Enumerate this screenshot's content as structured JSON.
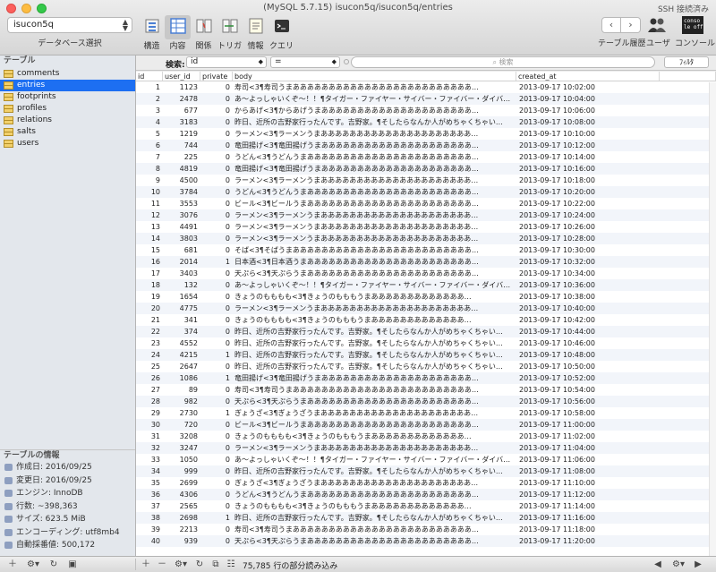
{
  "window": {
    "title": "(MySQL 5.7.15) isucon5q/isucon5q/entries",
    "ssh_status": "SSH 接続済み"
  },
  "toolbar": {
    "database_select": {
      "value": "isucon5q",
      "caption": "データベース選択"
    },
    "buttons": [
      {
        "label": "構造",
        "icon": "structure-icon"
      },
      {
        "label": "内容",
        "icon": "content-icon",
        "active": true
      },
      {
        "label": "関係",
        "icon": "relations-icon"
      },
      {
        "label": "トリガ",
        "icon": "triggers-icon"
      },
      {
        "label": "情報",
        "icon": "info-icon"
      },
      {
        "label": "クエリ",
        "icon": "query-icon"
      }
    ],
    "history_label": "テーブル履歴",
    "users_label": "ユーザ",
    "console_label": "コンソール",
    "console_badge": "conso\nle off"
  },
  "sidebar": {
    "header": "テーブル",
    "tables": [
      "comments",
      "entries",
      "footprints",
      "profiles",
      "relations",
      "salts",
      "users"
    ],
    "selected": "entries",
    "info_header": "テーブルの情報",
    "info": [
      "作成日: 2016/09/25",
      "変更日: 2016/09/25",
      "エンジン: InnoDB",
      "行数: ~398,363",
      "サイズ: 623.5 MiB",
      "エンコーディング: utf8mb4",
      "自動採番値: 500,172"
    ]
  },
  "filter": {
    "label": "検索:",
    "field": "id",
    "operator": "=",
    "search_placeholder": "検索",
    "button": "ﾌｨﾙﾀ"
  },
  "table": {
    "columns": [
      "id",
      "user_id",
      "private",
      "body",
      "created_at"
    ],
    "rows": [
      [
        "1",
        "1123",
        "0",
        "寿司<3¶寿司うまあああああああああああああああああああああああああ…",
        "2013-09-17 10:02:00"
      ],
      [
        "2",
        "2478",
        "0",
        "あ～よっしゃいくぞ～！！¶タイガー・ファイヤー・サイバー・ファイバー・ダイバ…",
        "2013-09-17 10:04:00"
      ],
      [
        "3",
        "677",
        "0",
        "からあげ<3¶からあげうまあああああああああああああああああああああ…",
        "2013-09-17 10:06:00"
      ],
      [
        "4",
        "3183",
        "0",
        "昨日、近所の吉野家行ったんです。吉野家。¶そしたらなんか人がめちゃくちゃい…",
        "2013-09-17 10:08:00"
      ],
      [
        "5",
        "1219",
        "0",
        "ラーメン<3¶ラーメンうまあああああああああああああああああああああ…",
        "2013-09-17 10:10:00"
      ],
      [
        "6",
        "744",
        "0",
        "竜田揚げ<3¶竜田揚げうまあああああああああああああああああああああ…",
        "2013-09-17 10:12:00"
      ],
      [
        "7",
        "225",
        "0",
        "うどん<3¶うどんうまあああああああああああああああああああああああ…",
        "2013-09-17 10:14:00"
      ],
      [
        "8",
        "4819",
        "0",
        "竜田揚げ<3¶竜田揚げうまあああああああああああああああああああああ…",
        "2013-09-17 10:16:00"
      ],
      [
        "9",
        "4500",
        "0",
        "ラーメン<3¶ラーメンうまあああああああああああああああああああああ…",
        "2013-09-17 10:18:00"
      ],
      [
        "10",
        "3784",
        "0",
        "うどん<3¶うどんうまあああああああああああああああああああああああ…",
        "2013-09-17 10:20:00"
      ],
      [
        "11",
        "3553",
        "0",
        "ビール<3¶ビールうまあああああああああああああああああああああああ…",
        "2013-09-17 10:22:00"
      ],
      [
        "12",
        "3076",
        "0",
        "ラーメン<3¶ラーメンうまあああああああああああああああああああああ…",
        "2013-09-17 10:24:00"
      ],
      [
        "13",
        "4491",
        "0",
        "ラーメン<3¶ラーメンうまあああああああああああああああああああああ…",
        "2013-09-17 10:26:00"
      ],
      [
        "14",
        "3803",
        "0",
        "ラーメン<3¶ラーメンうまあああああああああああああああああああああ…",
        "2013-09-17 10:28:00"
      ],
      [
        "15",
        "681",
        "0",
        "そば<3¶そばうまあああああああああああああああああああああああああ…",
        "2013-09-17 10:30:00"
      ],
      [
        "16",
        "2014",
        "1",
        "日本酒<3¶日本酒うまあああああああああああああああああああああああ…",
        "2013-09-17 10:32:00"
      ],
      [
        "17",
        "3403",
        "0",
        "天ぷら<3¶天ぷらうまあああああああああああああああああああああああ…",
        "2013-09-17 10:34:00"
      ],
      [
        "18",
        "132",
        "0",
        "あ～よっしゃいくぞ～！！¶タイガー・ファイヤー・サイバー・ファイバー・ダイバ…",
        "2013-09-17 10:36:00"
      ],
      [
        "19",
        "1654",
        "0",
        "きょうのもももも<3¶きょうのもももうまあああああああああああああ…",
        "2013-09-17 10:38:00"
      ],
      [
        "20",
        "4775",
        "0",
        "ラーメン<3¶ラーメンうまあああああああああああああああああああああ…",
        "2013-09-17 10:40:00"
      ],
      [
        "21",
        "341",
        "0",
        "きょうのもももも<3¶きょうのもももうまあああああああああああああ…",
        "2013-09-17 10:42:00"
      ],
      [
        "22",
        "374",
        "0",
        "昨日、近所の吉野家行ったんです。吉野家。¶そしたらなんか人がめちゃくちゃい…",
        "2013-09-17 10:44:00"
      ],
      [
        "23",
        "4552",
        "0",
        "昨日、近所の吉野家行ったんです。吉野家。¶そしたらなんか人がめちゃくちゃい…",
        "2013-09-17 10:46:00"
      ],
      [
        "24",
        "4215",
        "1",
        "昨日、近所の吉野家行ったんです。吉野家。¶そしたらなんか人がめちゃくちゃい…",
        "2013-09-17 10:48:00"
      ],
      [
        "25",
        "2647",
        "0",
        "昨日、近所の吉野家行ったんです。吉野家。¶そしたらなんか人がめちゃくちゃい…",
        "2013-09-17 10:50:00"
      ],
      [
        "26",
        "1086",
        "1",
        "竜田揚げ<3¶竜田揚げうまあああああああああああああああああああああ…",
        "2013-09-17 10:52:00"
      ],
      [
        "27",
        "89",
        "0",
        "寿司<3¶寿司うまあああああああああああああああああああああああああ…",
        "2013-09-17 10:54:00"
      ],
      [
        "28",
        "982",
        "0",
        "天ぷら<3¶天ぷらうまあああああああああああああああああああああああ…",
        "2013-09-17 10:56:00"
      ],
      [
        "29",
        "2730",
        "1",
        "ぎょうざ<3¶ぎょうざうまあああああああああああああああああああああ…",
        "2013-09-17 10:58:00"
      ],
      [
        "30",
        "720",
        "0",
        "ビール<3¶ビールうまあああああああああああああああああああああああ…",
        "2013-09-17 11:00:00"
      ],
      [
        "31",
        "3208",
        "0",
        "きょうのもももも<3¶きょうのもももうまあああああああああああああ…",
        "2013-09-17 11:02:00"
      ],
      [
        "32",
        "3247",
        "0",
        "ラーメン<3¶ラーメンうまあああああああああああああああああああああ…",
        "2013-09-17 11:04:00"
      ],
      [
        "33",
        "1050",
        "0",
        "あ～よっしゃいくぞ～！！¶タイガー・ファイヤー・サイバー・ファイバー・ダイバ…",
        "2013-09-17 11:06:00"
      ],
      [
        "34",
        "999",
        "0",
        "昨日、近所の吉野家行ったんです。吉野家。¶そしたらなんか人がめちゃくちゃい…",
        "2013-09-17 11:08:00"
      ],
      [
        "35",
        "2699",
        "0",
        "ぎょうざ<3¶ぎょうざうまあああああああああああああああああああああ…",
        "2013-09-17 11:10:00"
      ],
      [
        "36",
        "4306",
        "0",
        "うどん<3¶うどんうまあああああああああああああああああああああああ…",
        "2013-09-17 11:12:00"
      ],
      [
        "37",
        "2565",
        "0",
        "きょうのもももも<3¶きょうのもももうまあああああああああああああ…",
        "2013-09-17 11:14:00"
      ],
      [
        "38",
        "2698",
        "1",
        "昨日、近所の吉野家行ったんです。吉野家。¶そしたらなんか人がめちゃくちゃい…",
        "2013-09-17 11:16:00"
      ],
      [
        "39",
        "2213",
        "0",
        "寿司<3¶寿司うまあああああああああああああああああああああああああ…",
        "2013-09-17 11:18:00"
      ],
      [
        "40",
        "939",
        "0",
        "天ぷら<3¶天ぷらうまあああああああああああああああああああああああ…",
        "2013-09-17 11:20:00"
      ]
    ]
  },
  "status": {
    "text": "75,785 行の部分読み込み"
  },
  "colors": {
    "selection": "#1d6ff2",
    "sidebar_bg": "#e3e7ec",
    "row_alt": "#f2f5fa"
  }
}
